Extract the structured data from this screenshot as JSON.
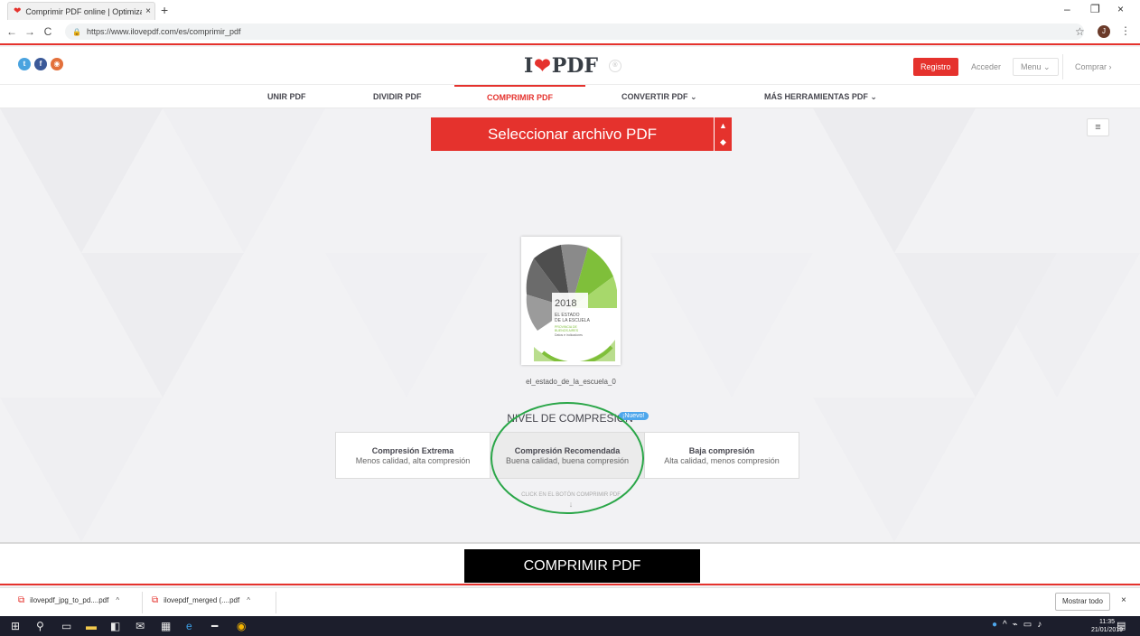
{
  "browser": {
    "tab_title": "Comprimir PDF online | Optimiza",
    "tab_close": "×",
    "new_tab": "+",
    "url": "https://www.ilovepdf.com/es/comprimir_pdf",
    "win_min": "–",
    "win_max": "❐",
    "win_close": "×",
    "back": "←",
    "forward": "→",
    "reload": "C",
    "star": "☆",
    "profile_initial": "J",
    "kebab": "⋮"
  },
  "header": {
    "logo_left": "I",
    "logo_right": "PDF",
    "registro": "Registro",
    "acceder": "Acceder",
    "menu": "Menu ⌄",
    "comprar": "Comprar ›"
  },
  "nav": {
    "items": [
      "UNIR PDF",
      "DIVIDIR PDF",
      "COMPRIMIR PDF",
      "CONVERTIR PDF ⌄",
      "MÁS HERRAMIENTAS PDF ⌄"
    ]
  },
  "main": {
    "select_button": "Seleccionar archivo PDF",
    "side_menu": "≡",
    "thumbnail": {
      "year": "2018",
      "line1": "EL ESTADO",
      "line2": "DE LA ESCUELA",
      "line3": "PROVINCIA DE",
      "line4": "BUENOS AIRES",
      "line5": "Datos e indicadores"
    },
    "filename": "el_estado_de_la_escuela_0",
    "nivel_title": "NIVEL DE COMPRESIÓN",
    "nuevo_badge": "¡Nuevo!",
    "levels": [
      {
        "title": "Compresión Extrema",
        "desc": "Menos calidad, alta compresión"
      },
      {
        "title": "Compresión Recomendada",
        "desc": "Buena calidad, buena compresión"
      },
      {
        "title": "Baja compresión",
        "desc": "Alta calidad, menos compresión"
      }
    ],
    "hint": "CLICK EN EL BOTÓN COMPRIMIR PDF",
    "hint_arrow": "↓"
  },
  "action": {
    "compress_button": "COMPRIMIR PDF"
  },
  "downloads": {
    "items": [
      "ilovepdf_jpg_to_pd....pdf",
      "ilovepdf_merged (....pdf"
    ],
    "caret": "^",
    "show_all": "Mostrar todo",
    "close": "×"
  },
  "taskbar": {
    "time": "11:35",
    "date": "21/01/2019"
  },
  "colors": {
    "brand_red": "#e5322d",
    "annotation_green": "#2aa648",
    "nuevo_blue": "#4ea7ec"
  }
}
